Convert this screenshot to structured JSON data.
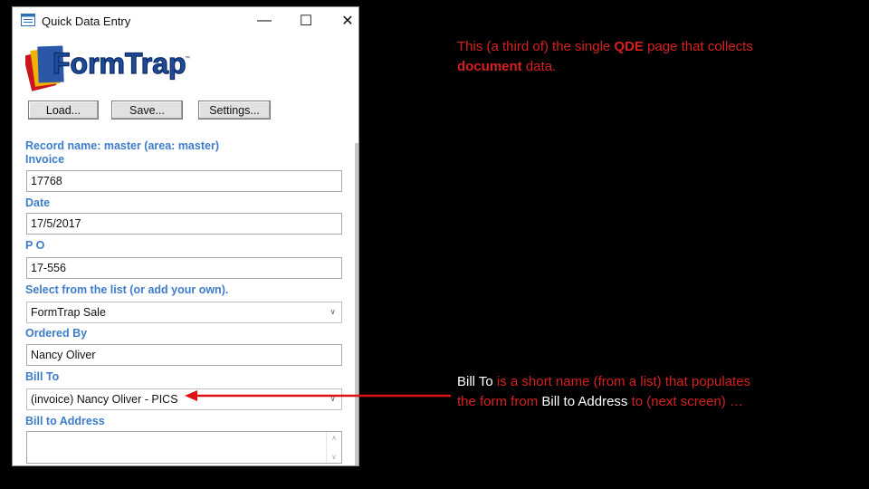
{
  "window": {
    "title": "Quick Data Entry",
    "controls": {
      "minimize": "—",
      "maximize": "☐",
      "close": "✕"
    },
    "logo_text": "FormTrap",
    "logo_tm": "™"
  },
  "toolbar": {
    "load_label": "Load...",
    "save_label": "Save...",
    "settings_label": "Settings..."
  },
  "form": {
    "record_name": "Record name: master (area: master)",
    "invoice": {
      "label": "Invoice",
      "value": "17768"
    },
    "date": {
      "label": "Date",
      "value": "17/5/2017"
    },
    "po": {
      "label": "P O",
      "value": "17-556"
    },
    "select_list": {
      "label": "Select from the list (or add your own).",
      "value": "FormTrap Sale"
    },
    "ordered_by": {
      "label": "Ordered  By",
      "value": "Nancy Oliver"
    },
    "bill_to": {
      "label": "Bill  To",
      "value": "(invoice) Nancy Oliver - PICS"
    },
    "bill_to_address": {
      "label": "Bill to  Address",
      "value": ""
    }
  },
  "annotations": {
    "note1": {
      "a": "This (a third of) the single ",
      "b": "QDE",
      "c": " page that collects ",
      "d": "document",
      "e": " data."
    },
    "note2": {
      "a": "Bill To",
      "b": " is a short name (from a list) that populates the form from ",
      "c": "Bill to Address",
      "d": "  to (next screen)  …"
    }
  },
  "colors": {
    "label_blue": "#3d7cc9",
    "annotation_red": "#d62020",
    "arrow_red": "#e01010"
  }
}
